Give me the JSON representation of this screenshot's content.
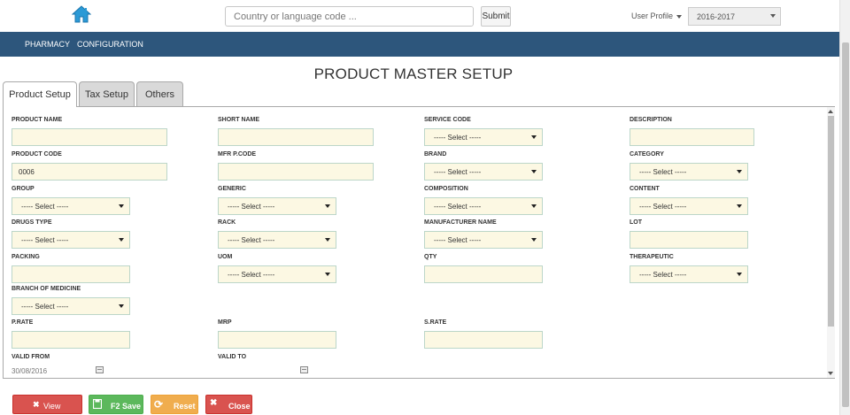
{
  "header": {
    "search_placeholder": "Country or language code ...",
    "submit_label": "Submit",
    "user_profile_label": "User Profile",
    "year_value": "2016-2017"
  },
  "nav": {
    "items": [
      "PHARMACY",
      "CONFIGURATION"
    ]
  },
  "page": {
    "title": "PRODUCT MASTER SETUP"
  },
  "tabs": [
    "Product Setup",
    "Tax Setup",
    "Others"
  ],
  "form": {
    "select_placeholder": "----- Select -----",
    "labels": {
      "product_name": "PRODUCT NAME",
      "short_name": "SHORT NAME",
      "service_code": "SERVICE CODE",
      "description": "DESCRIPTION",
      "product_code": "PRODUCT CODE",
      "mfr_pcode": "MFR P.CODE",
      "brand": "BRAND",
      "category": "CATEGORY",
      "group": "GROUP",
      "generic": "GENERIC",
      "composition": "COMPOSITION",
      "content": "CONTENT",
      "drugs_type": "DRUGS TYPE",
      "rack": "RACK",
      "manufacturer_name": "MANUFACTURER NAME",
      "lot": "LOT",
      "packing": "PACKING",
      "uom": "UOM",
      "qty": "QTY",
      "therapeutic": "THERAPEUTIC",
      "branch_of_medicine": "BRANCH OF MEDICINE",
      "prate": "P.RATE",
      "mrp": "MRP",
      "srate": "S.RATE",
      "valid_from": "VALID FROM",
      "valid_to": "VALID TO"
    },
    "values": {
      "product_code": "0006",
      "valid_from": "30/08/2016"
    }
  },
  "actions": {
    "view": "View",
    "save": "F2 Save",
    "reset": "Reset",
    "close": "Close"
  },
  "colors": {
    "nav_bg": "#2d567c",
    "field_bg": "#fcf8e3",
    "view_btn": "#d9534f",
    "save_btn": "#5cb85c",
    "reset_btn": "#f0ad4e",
    "close_btn": "#d9534f"
  }
}
